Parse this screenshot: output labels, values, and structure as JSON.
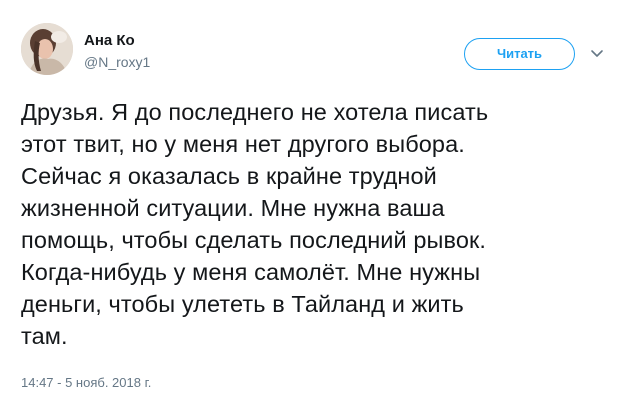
{
  "author": {
    "display_name": "Ана Ко",
    "handle": "@N_roxy1"
  },
  "follow_button": {
    "label": "Читать"
  },
  "tweet": {
    "text": "Друзья. Я до последнего не хотела писать\nэтот твит, но у меня нет другого выбора.\nСейчас я оказалась в крайне трудной\nжизненной ситуации. Мне нужна ваша\nпомощь, чтобы сделать последний рывок.\nКогда-нибудь у меня самолёт. Мне нужны\nденьги, чтобы улететь в Тайланд и жить\nтам.",
    "timestamp": "14:47 - 5 нояб. 2018 г."
  },
  "icons": {
    "more": "chevron-down-icon",
    "avatar": "profile-photo"
  },
  "colors": {
    "accent": "#1da1f2",
    "text": "#14171a",
    "secondary": "#657786",
    "background": "#ffffff"
  }
}
